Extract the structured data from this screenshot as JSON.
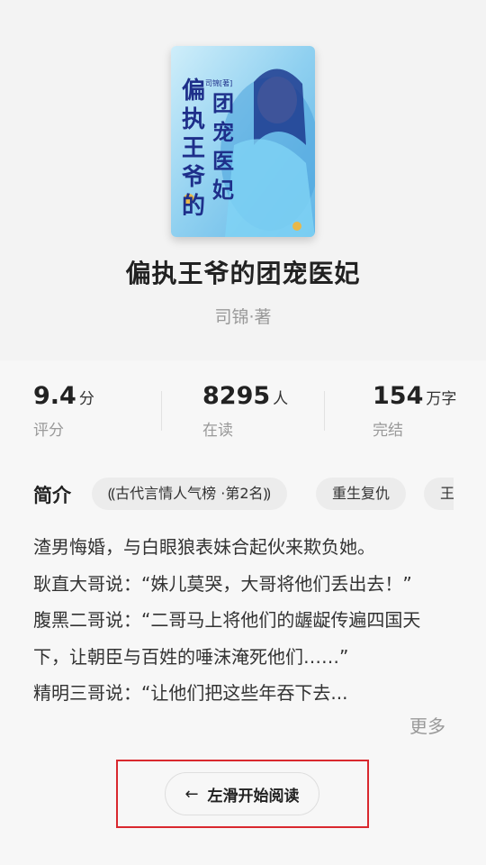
{
  "book": {
    "title": "偏执王爷的团宠医妃",
    "author": "司锦·著",
    "cover_title_text": "偏执王爷的团宠医妃",
    "cover_author_text": "司锦[著]"
  },
  "stats": [
    {
      "value": "9.4",
      "unit": "分",
      "label": "评分"
    },
    {
      "value": "8295",
      "unit": "人",
      "label": "在读"
    },
    {
      "value": "154",
      "unit": "万字",
      "label": "完结"
    }
  ],
  "intro": {
    "heading": "简介",
    "tags": [
      "古代言情人气榜 ·第2名",
      "重生复仇",
      "王"
    ],
    "lines": [
      "渣男悔婚，与白眼狼表妹合起伙来欺负她。",
      "耿直大哥说：“姝儿莫哭，大哥将他们丢出去！”",
      "腹黑二哥说：“二哥马上将他们的龌龊传遍四国天下，让朝臣与百姓的唾沫淹死他们……”",
      "精明三哥说：“让他们把这些年吞下去..."
    ],
    "more_label": "更多"
  },
  "read_button": {
    "label": "左滑开始阅读",
    "arrow": "←"
  },
  "colors": {
    "highlight_border": "#d9282e",
    "cover_bg": "#8fcff0"
  }
}
